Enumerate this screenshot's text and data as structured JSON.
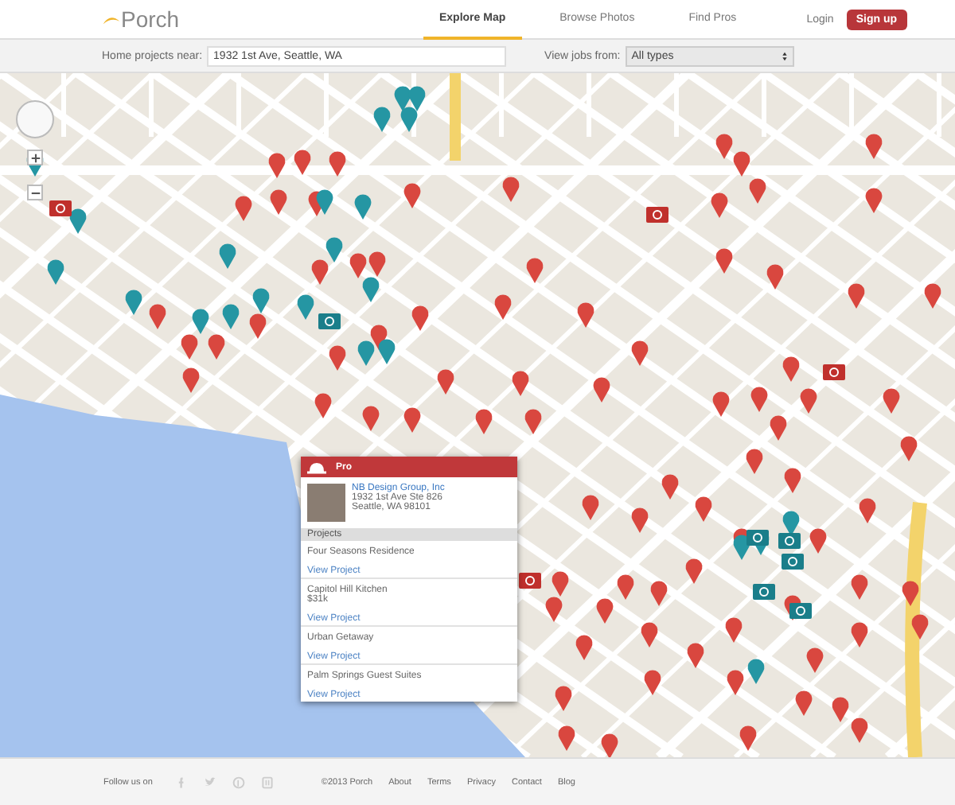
{
  "header": {
    "logo": "Porch",
    "nav": [
      {
        "label": "Explore Map",
        "selected": true
      },
      {
        "label": "Browse Photos",
        "selected": false
      },
      {
        "label": "Find Pros",
        "selected": false
      }
    ],
    "login": "Login",
    "signup": "Sign up"
  },
  "filter_bar": {
    "location_label": "Home projects near:",
    "location_value": "1932 1st Ave, Seattle, WA",
    "type_label": "View jobs from:",
    "type_value": "All types"
  },
  "map": {
    "popup": {
      "badge": "Pro",
      "company": "NB Design Group, Inc",
      "address_lines": [
        "1932 1st Ave Ste 826",
        "Seattle, WA 98101"
      ],
      "section_title": "Projects",
      "projects": [
        {
          "name": "Four Seasons Residence",
          "link": "View Project"
        },
        {
          "name": "Capitol Hill Kitchen",
          "price": "$31k",
          "link": "View Project"
        },
        {
          "name": "Urban Getaway",
          "link": "View Project"
        },
        {
          "name": "Palm Springs Guest Suites",
          "link": "View Project"
        }
      ]
    }
  },
  "footer": {
    "follow_label": "Follow us on",
    "copyright": "©2013 Porch",
    "links": [
      "About",
      "Terms",
      "Privacy",
      "Contact",
      "Blog"
    ]
  }
}
